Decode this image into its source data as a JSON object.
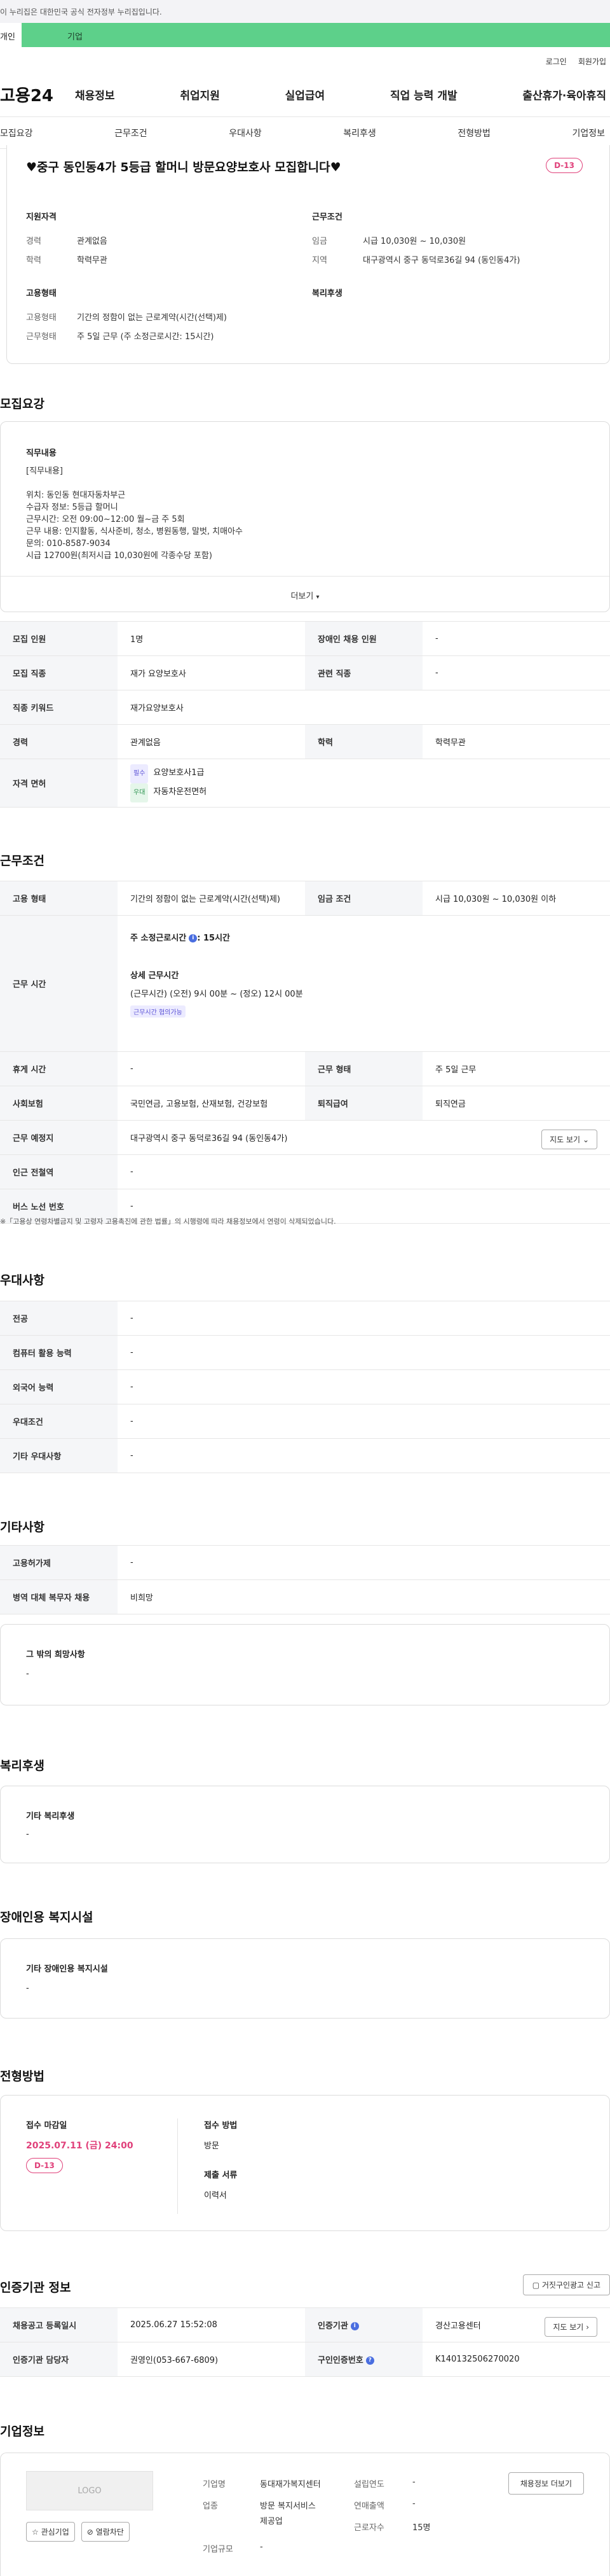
{
  "gov_banner": "이 누리집은 대한민국 공식 전자정부 누리집입니다.",
  "top_tabs": {
    "personal": "개인",
    "company": "기업"
  },
  "util": {
    "login": "로그인",
    "join": "회원가입"
  },
  "gnb": {
    "logo": "고용24",
    "menu": [
      "채용정보",
      "취업지원",
      "실업급여",
      "직업 능력 개발",
      "출산휴가·육아휴직"
    ]
  },
  "anchor_nav": [
    "모집요강",
    "근무조건",
    "우대사항",
    "복리후생",
    "전형방법",
    "기업정보"
  ],
  "summary": {
    "title": "♥중구 동인동4가 5등급 할머니 방문요양보호사 모집합니다♥",
    "dday": "D-13",
    "qual_title": "지원자격",
    "career_label": "경력",
    "career_value": "관계없음",
    "edu_label": "학력",
    "edu_value": "학력무관",
    "cond_title": "근무조건",
    "wage_label": "임금",
    "wage_value": "시급 10,030원 ~ 10,030원",
    "region_label": "지역",
    "region_value": "대구광역시 중구 동덕로36길 94 (동인동4가)",
    "employ_title": "고용형태",
    "type_label": "고용형태",
    "type_value": "기간의 정함이 없는 근로계약(시간(선택)제)",
    "worktype_label": "근무형태",
    "worktype_value": "주 5일 근무 (주 소정근로시간: 15시간)",
    "welfare_title": "복리후생"
  },
  "recruit": {
    "section_title": "모집요강",
    "duty_title": "직무내용",
    "duty_lines": [
      "[직무내용]",
      "",
      "위치: 동인동 현대자동차부근",
      "수급자 정보: 5등급 할머니",
      "근무시간: 오전 09:00~12:00 월~금 주 5회",
      "근무 내용: 인지활동, 식사준비, 청소, 병원동행, 말벗, 치매아수",
      "문의: 010-8587-9034",
      "시급 12700원(최저시급 10,030원에 각종수당 포함)"
    ],
    "more": "더보기",
    "rows": {
      "headcount_label": "모집 인원",
      "headcount_value": "1명",
      "disabled_label": "장애인 채용 인원",
      "disabled_value": "-",
      "job_label": "모집 직종",
      "job_value": "재가 요양보호사",
      "related_label": "관련 직종",
      "related_value": "-",
      "keyword_label": "직종 키워드",
      "keyword_value": "재가요양보호사",
      "career_label": "경력",
      "career_value": "관계없음",
      "edu_label": "학력",
      "edu_value": "학력무관",
      "license_label": "자격 면허",
      "license_tag1": "필수",
      "license1": "요양보호사1급",
      "license_tag2": "우대",
      "license2": "자동차운전면허"
    }
  },
  "work": {
    "section_title": "근무조건",
    "type_label": "고용 형태",
    "type_value": "기간의 정함이 없는 근로계약(시간(선택)제)",
    "wage_label": "임금 조건",
    "wage_value": "시급 10,030원 ~ 10,030원 이하",
    "hours_label": "근무 시간",
    "hours_week_prefix": "주 소정근로시간",
    "hours_week_value": ": 15시간",
    "hours_detail_title": "상세 근무시간",
    "hours_detail": "(근무시간) (오전) 9시 00분 ~ (정오) 12시 00분",
    "hours_tag": "근무시간 협의가능",
    "break_label": "휴게 시간",
    "break_value": "-",
    "shift_label": "근무 형태",
    "shift_value": "주 5일 근무",
    "insurance_label": "사회보험",
    "insurance_value": "국민연금, 고용보험, 산재보험, 건강보험",
    "pension_label": "퇴직급여",
    "pension_value": "퇴직연금",
    "place_label": "근무 예정지",
    "place_value": "대구광역시 중구 동덕로36길 94 (동인동4가)",
    "map_button": "지도 보기",
    "station_label": "인근 전철역",
    "station_value": "-",
    "bus_label": "버스 노선 번호",
    "bus_value": "-",
    "note": "※「고용상 연령차별금지 및 고령자 고용촉진에 관한 법률」의 시행령에 따라 채용정보에서 연령이 삭제되었습니다."
  },
  "prefer": {
    "section_title": "우대사항",
    "rows": [
      {
        "label": "전공",
        "value": "-"
      },
      {
        "label": "컴퓨터 활용 능력",
        "value": "-"
      },
      {
        "label": "외국어 능력",
        "value": "-"
      },
      {
        "label": "우대조건",
        "value": "-"
      },
      {
        "label": "기타 우대사항",
        "value": "-"
      }
    ]
  },
  "etc": {
    "section_title": "기타사항",
    "rows": [
      {
        "label": "고용허가제",
        "value": "-"
      },
      {
        "label": "병역 대체 복무자 채용",
        "value": "비희망"
      }
    ],
    "other_title": "그 밖의 희망사항",
    "other_value": "-"
  },
  "welfare": {
    "section_title": "복리후생",
    "card_title": "기타 복리후생",
    "card_value": "-"
  },
  "disability": {
    "section_title": "장애인용 복지시설",
    "card_title": "기타 장애인용 복지시설",
    "card_value": "-"
  },
  "selection": {
    "section_title": "전형방법",
    "deadline_title": "접수 마감일",
    "deadline_value": "2025.07.11 (금) 24:00",
    "dday": "D-13",
    "method_title": "접수 방법",
    "method_value": "방문",
    "docs_title": "제출 서류",
    "docs_value": "이력서"
  },
  "agency": {
    "section_title": "인증기관 정보",
    "report_button": "거짓구인광고 신고",
    "reg_label": "채용공고 등록일시",
    "reg_value": "2025.06.27 15:52:08",
    "org_label": "인증기관",
    "org_value": "경산고용센터",
    "map_button": "지도 보기",
    "manager_label": "인증기관 담당자",
    "manager_value": "권영인(053-667-6809)",
    "id_label": "구인인증번호",
    "id_value": "K140132506270020"
  },
  "company": {
    "section_title": "기업정보",
    "logo_text": "LOGO",
    "fav_button": "관심기업",
    "block_button": "열람차단",
    "name_label": "기업명",
    "name_value": "동대재가복지센터",
    "year_label": "설립연도",
    "year_value": "-",
    "industry_label": "업종",
    "industry_value_1": "방문 복지서비스",
    "industry_value_2": "제공업",
    "revenue_label": "연매출액",
    "revenue_value": "-",
    "employees_label": "근로자수",
    "employees_value": "15명",
    "size_label": "기업규모",
    "size_value": "-",
    "jobs_button": "채용정보 더보기"
  },
  "colors": {
    "accent": "#e0407a",
    "green_bar": "#5dd08a",
    "info_blue": "#4a6ee0"
  }
}
